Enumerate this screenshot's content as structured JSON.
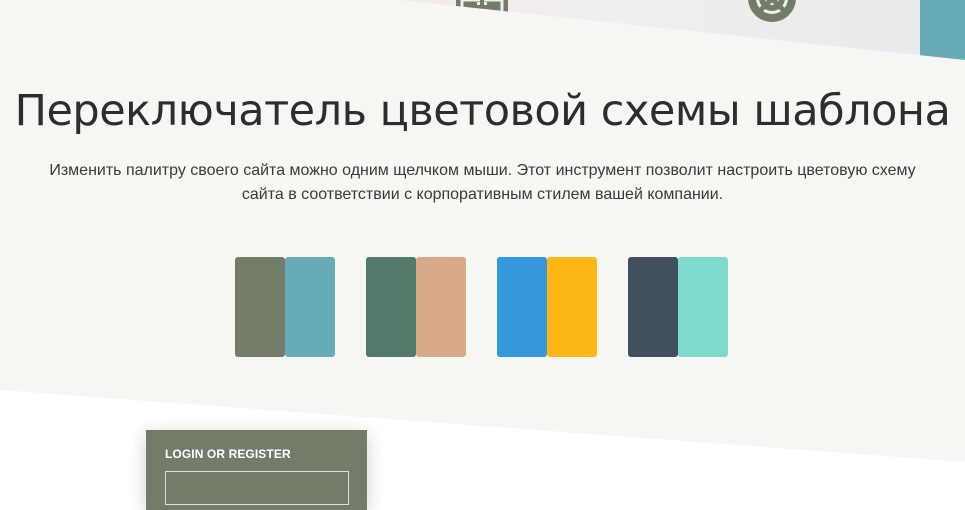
{
  "colors": {
    "section_background": "#f6f6f2",
    "hero_accent": "#66abb6",
    "title_text": "#2d2d2b",
    "login_background": "#727c68"
  },
  "hero": {
    "icons": [
      "first-aid-icon",
      "lifebuoy-icon"
    ]
  },
  "section": {
    "title": "Переключатель цветовой схемы шаблона",
    "description": "Изменить палитру своего сайта можно одним щелчком мыши. Этот инструмент позволит настроить цветовую схему сайта в соответствии с корпоративным стилем вашей компании."
  },
  "palettes": [
    {
      "primary": "#737c69",
      "secondary": "#66abb6"
    },
    {
      "primary": "#53796a",
      "secondary": "#d9aa89"
    },
    {
      "primary": "#3498db",
      "secondary": "#fdb714"
    },
    {
      "primary": "#3f4f5e",
      "secondary": "#7edbcb"
    }
  ],
  "login": {
    "title": "LOGIN OR REGISTER",
    "input_value": "",
    "input_placeholder": ""
  }
}
